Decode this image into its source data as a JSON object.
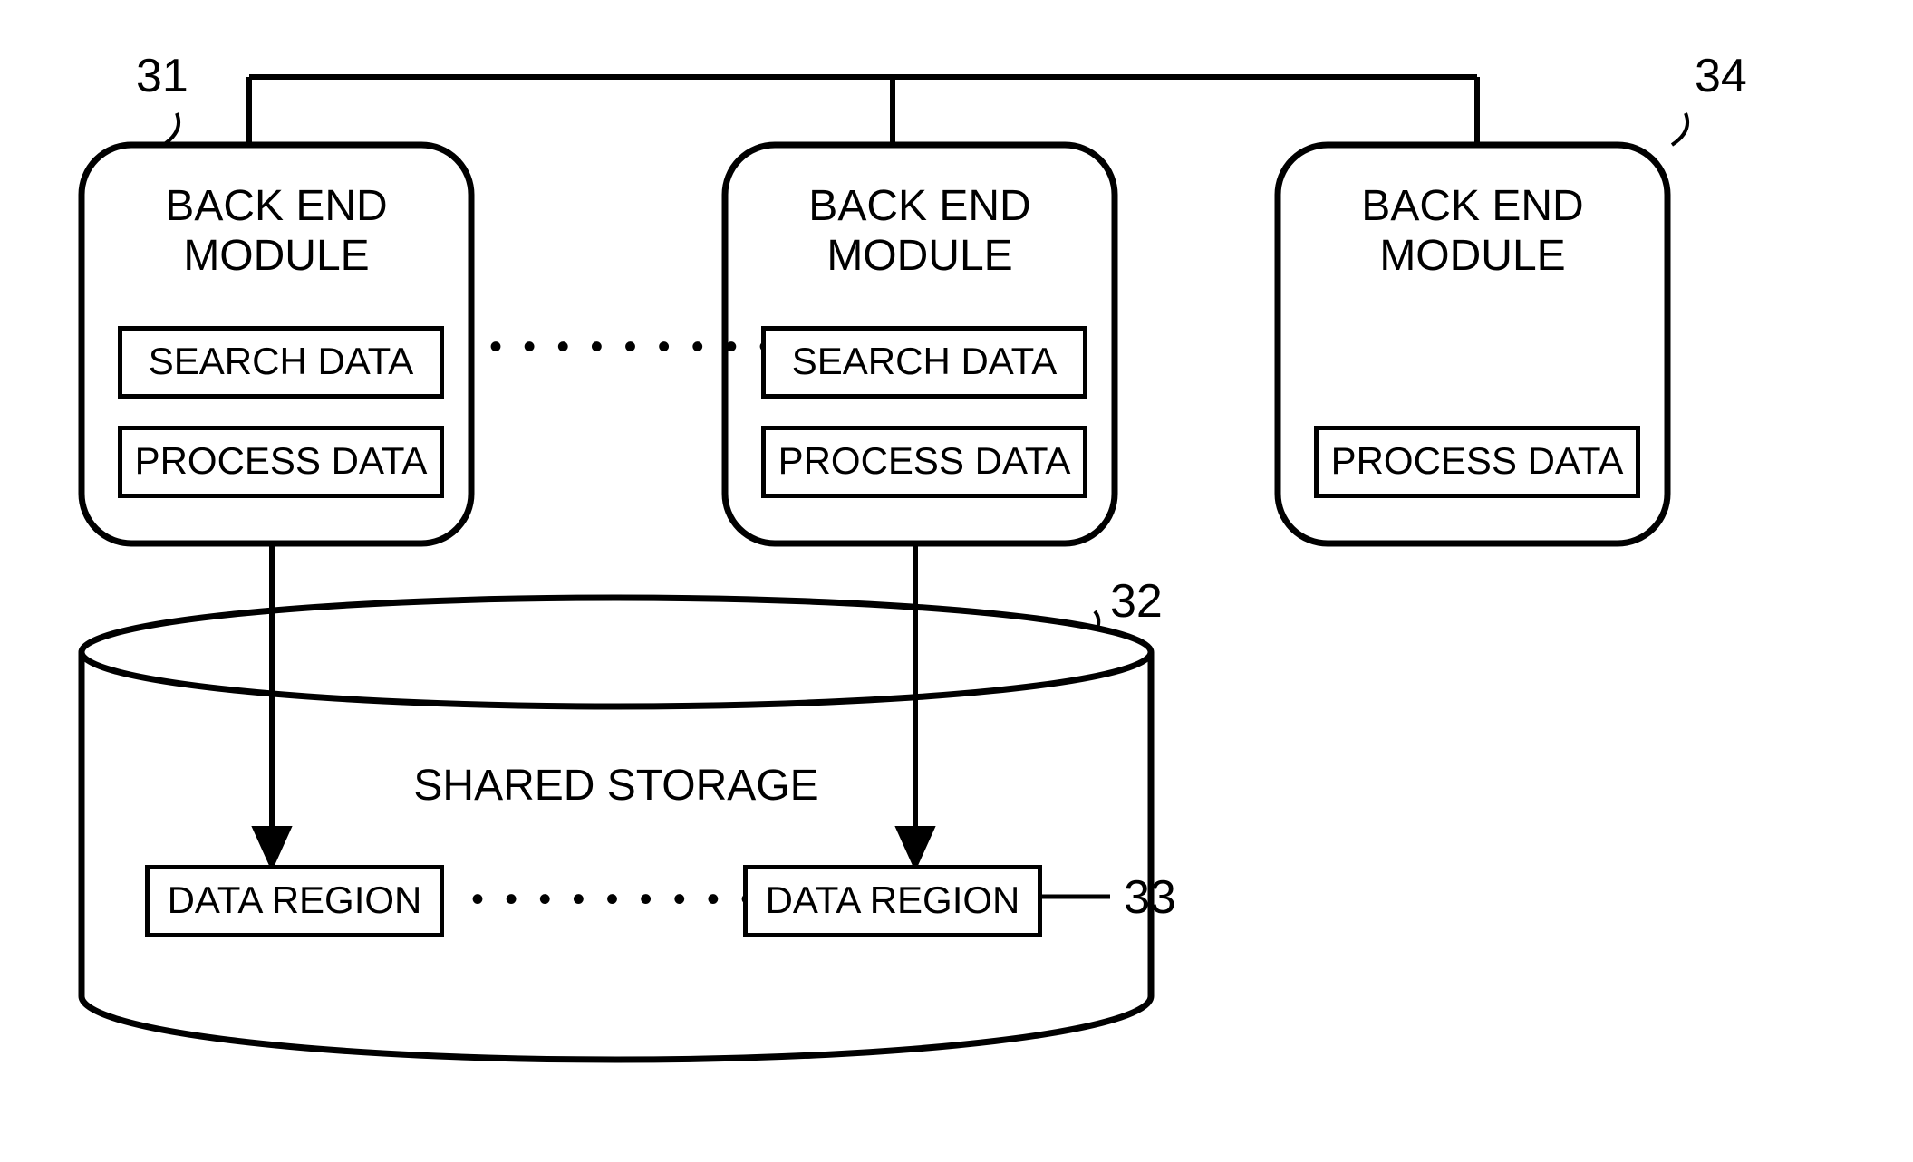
{
  "reference_labels": {
    "ref31": "31",
    "ref32": "32",
    "ref33": "33",
    "ref34": "34"
  },
  "modules": {
    "left": {
      "title": "BACK END\nMODULE",
      "search": "SEARCH DATA",
      "process": "PROCESS DATA"
    },
    "middle": {
      "title": "BACK END\nMODULE",
      "search": "SEARCH DATA",
      "process": "PROCESS DATA"
    },
    "right": {
      "title": "BACK END\nMODULE",
      "process": "PROCESS DATA"
    }
  },
  "storage": {
    "title": "SHARED STORAGE",
    "regions": {
      "left": "DATA REGION",
      "right": "DATA REGION"
    }
  },
  "ellipsis": "• • • • • • • • •"
}
